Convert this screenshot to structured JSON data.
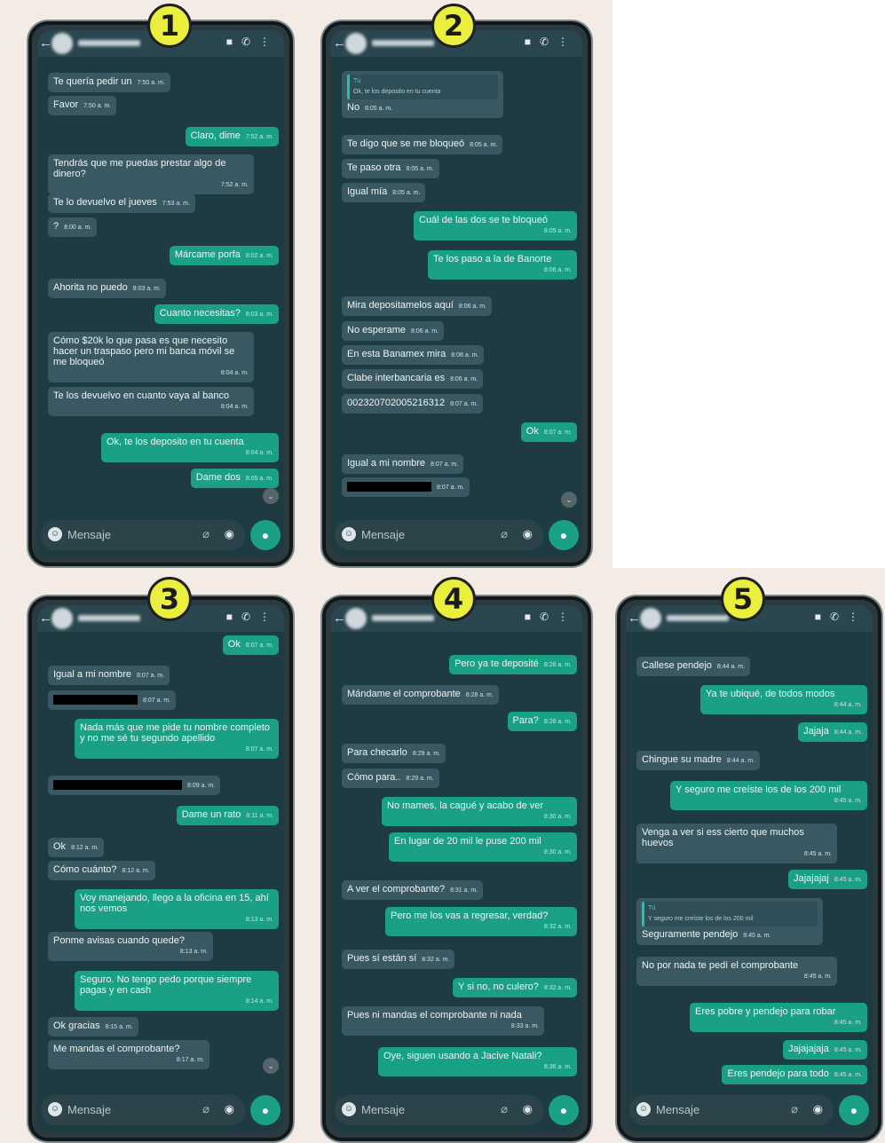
{
  "badges": [
    "1",
    "2",
    "3",
    "4",
    "5"
  ],
  "input_placeholder": "Mensaje",
  "icons": {
    "back": "back-arrow-icon",
    "video": "video-call-icon",
    "phone": "voice-call-icon",
    "menu": "more-options-icon",
    "emoji": "emoji-icon",
    "attach": "attach-icon",
    "camera": "camera-icon",
    "mic": "microphone-icon"
  },
  "colors": {
    "incoming": "#3a5861",
    "outgoing": "#1aa085",
    "chat_bg": "#1f3b42",
    "badge": "#e9ef3c"
  },
  "p1": [
    {
      "text": "Te quería pedir un",
      "time": "7:50 a. m."
    },
    {
      "text": "Favor",
      "time": "7:50 a. m."
    },
    {
      "text": "Claro, dime",
      "time": "7:52 a. m."
    },
    {
      "text": "Tendrás que me puedas prestar algo de dinero?",
      "time": "7:52 a. m."
    },
    {
      "text": "Te lo devuelvo el jueves",
      "time": "7:53 a. m."
    },
    {
      "text": "?",
      "time": "8:00 a. m."
    },
    {
      "text": "Márcame porfa",
      "time": "8:02 a. m."
    },
    {
      "text": "Ahorita no puedo",
      "time": "8:03 a. m."
    },
    {
      "text": "Cuanto necesitas?",
      "time": "8:03 a. m."
    },
    {
      "text": "Cómo $20k lo que pasa es que necesito hacer un traspaso pero mi banca móvil se me bloqueó",
      "time": "8:04 a. m."
    },
    {
      "text": "Te los devuelvo en cuanto vaya al banco",
      "time": "8:04 a. m."
    },
    {
      "text": "Ok, te los deposito en tu cuenta",
      "time": "8:04 a. m."
    },
    {
      "text": "Dame dos",
      "time": "8:05 a. m."
    }
  ],
  "p2": {
    "quote_author": "Tú",
    "quote_text": "Ok, te los deposito en tu cuenta",
    "messages": [
      {
        "text": "No",
        "time": "8:05 a. m."
      },
      {
        "text": "Te digo que se me bloqueó",
        "time": "8:05 a. m."
      },
      {
        "text": "Te paso otra",
        "time": "8:05 a. m."
      },
      {
        "text": "Igual mía",
        "time": "8:05 a. m."
      },
      {
        "text": "Cuál de las dos se te bloqueó",
        "time": "8:05 a. m."
      },
      {
        "text": "Te los paso a la de Banorte",
        "time": "8:06 a. m."
      },
      {
        "text": "Mira depositamelos aquí",
        "time": "8:06 a. m."
      },
      {
        "text": "No esperame",
        "time": "8:06 a. m."
      },
      {
        "text": "En esta Banamex mira",
        "time": "8:06 a. m."
      },
      {
        "text": "Clabe interbancaria es",
        "time": "8:06 a. m."
      },
      {
        "text": "002320702005216312",
        "time": "8:07 a. m."
      },
      {
        "text": "Ok",
        "time": "8:07 a. m."
      },
      {
        "text": "Igual a mi nombre",
        "time": "8:07 a. m."
      },
      {
        "text": "",
        "time": "8:07 a. m."
      }
    ]
  },
  "p3": [
    {
      "text": "Ok",
      "time": "8:07 a. m."
    },
    {
      "text": "Igual a mi nombre",
      "time": "8:07 a. m."
    },
    {
      "text": "",
      "time": "8:07 a. m."
    },
    {
      "text": "Nada más que me pide tu nombre completo y no me sé tu segundo apellido",
      "time": "8:07 a. m."
    },
    {
      "text": "",
      "time": "8:09 a. m."
    },
    {
      "text": "Dame un rato",
      "time": "8:11 a. m."
    },
    {
      "text": "Ok",
      "time": "8:12 a. m."
    },
    {
      "text": "Cómo cuánto?",
      "time": "8:12 a. m."
    },
    {
      "text": "Voy manejando, llego a la oficina en 15, ahí nos vemos",
      "time": "8:13 a. m."
    },
    {
      "text": "Ponme avisas cuando quede?",
      "time": "8:13 a. m."
    },
    {
      "text": "Seguro. No tengo pedo porque siempre pagas y en cash",
      "time": "8:14 a. m."
    },
    {
      "text": "Ok gracias",
      "time": "8:15 a. m."
    },
    {
      "text": "Me mandas el comprobante?",
      "time": "8:17 a. m."
    }
  ],
  "p4": [
    {
      "text": "Pero ya te deposité",
      "time": "8:28 a. m."
    },
    {
      "text": "Mándame el comprobante",
      "time": "8:28 a. m."
    },
    {
      "text": "Para?",
      "time": "8:28 a. m."
    },
    {
      "text": "Para checarlo",
      "time": "8:29 a. m."
    },
    {
      "text": "Cómo para..",
      "time": "8:29 a. m."
    },
    {
      "text": "No mames, la cagué y acabo de ver",
      "time": "8:30 a. m."
    },
    {
      "text": "En lugar de 20 mil le puse 200 mil",
      "time": "8:30 a. m."
    },
    {
      "text": "A ver el comprobante?",
      "time": "8:31 a. m."
    },
    {
      "text": "Pero me los vas a regresar, verdad?",
      "time": "8:32 a. m."
    },
    {
      "text": "Pues sí están sí",
      "time": "8:32 a. m."
    },
    {
      "text": "Y si no, no culero?",
      "time": "8:32 a. m."
    },
    {
      "text": "Pues ni mandas el comprobante ni nada",
      "time": "8:33 a. m."
    },
    {
      "text": "Oye, siguen usando a Jacive Natali?",
      "time": "8:36 a. m."
    }
  ],
  "p5": {
    "quote_author": "Tú",
    "quote_text": "Y seguro me creíste los de los 200 mil",
    "messages": [
      {
        "text": "Callese pendejo",
        "time": "8:44 a. m."
      },
      {
        "text": "Ya te ubiqué, de todos modos",
        "time": "8:44 a. m."
      },
      {
        "text": "Jajaja",
        "time": "8:44 a. m."
      },
      {
        "text": "Chingue su madre",
        "time": "8:44 a. m."
      },
      {
        "text": "Y seguro me creíste los de los 200 mil",
        "time": "8:45 a. m."
      },
      {
        "text": "Venga a ver si ess cierto que muchos huevos",
        "time": "8:45 a. m."
      },
      {
        "text": "Jajajajaj",
        "time": "8:45 a. m."
      },
      {
        "text": "Seguramente pendejo",
        "time": "8:45 a. m."
      },
      {
        "text": "No por nada te pedí el comprobante",
        "time": "8:45 a. m."
      },
      {
        "text": "Eres pobre y pendejo para robar",
        "time": "8:45 a. m."
      },
      {
        "text": "Jajajajaja",
        "time": "8:45 a. m."
      },
      {
        "text": "Eres pendejo para todo",
        "time": "8:45 a. m."
      }
    ]
  }
}
